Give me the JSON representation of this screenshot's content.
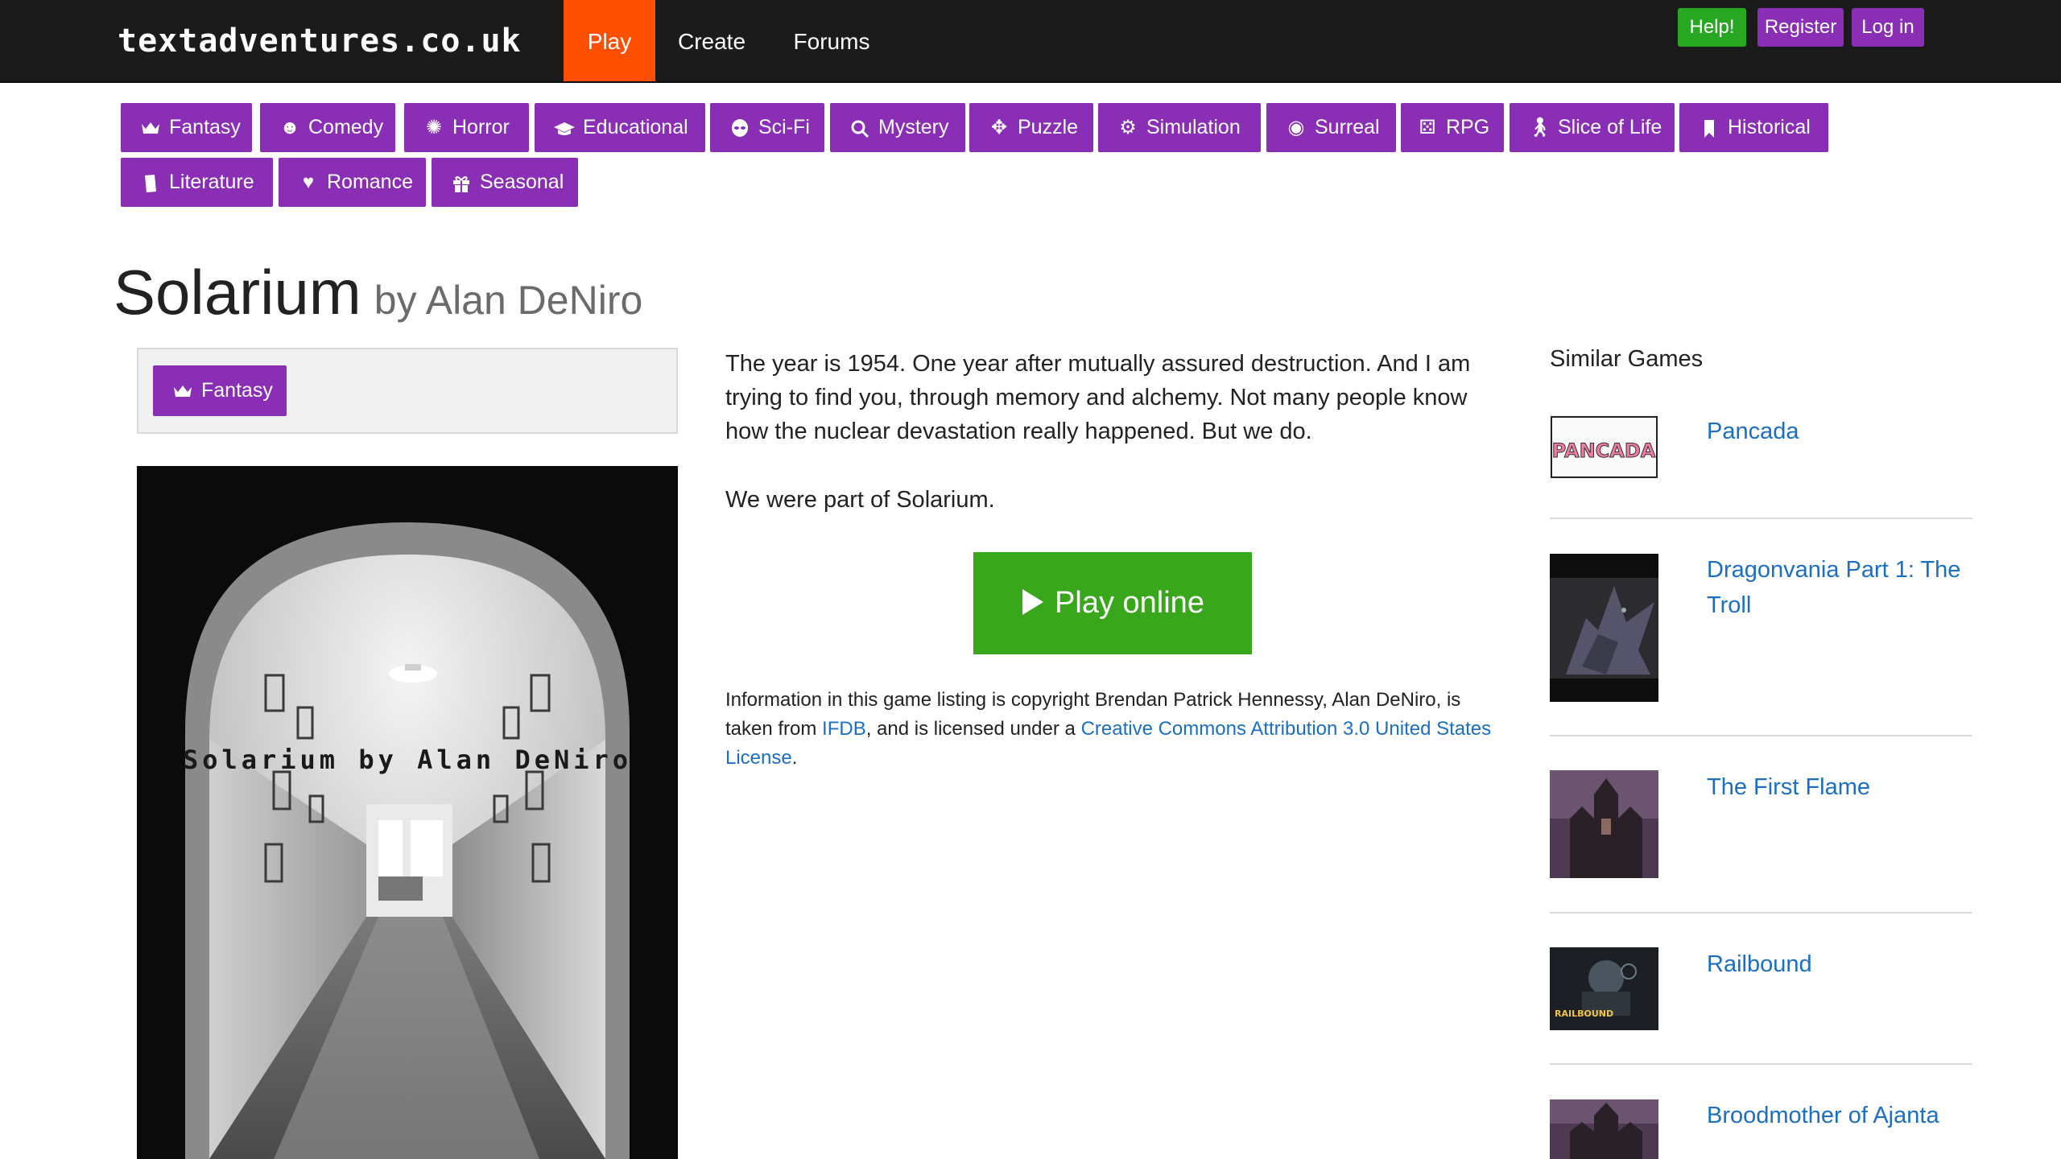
{
  "site": {
    "logo": "textadventures.co.uk",
    "nav": [
      {
        "label": "Play",
        "active": true
      },
      {
        "label": "Create",
        "active": false
      },
      {
        "label": "Forums",
        "active": false
      }
    ],
    "top_buttons": [
      {
        "label": "Help!",
        "color": "#27a722"
      },
      {
        "label": "Register",
        "color": "#8a2fb5"
      },
      {
        "label": "Log in",
        "color": "#8a2fb5"
      }
    ]
  },
  "categories": [
    {
      "label": "Fantasy",
      "icon": "crown-icon"
    },
    {
      "label": "Comedy",
      "icon": "smiley-icon"
    },
    {
      "label": "Horror",
      "icon": "spider-icon"
    },
    {
      "label": "Educational",
      "icon": "graduation-cap-icon"
    },
    {
      "label": "Sci-Fi",
      "icon": "alien-icon"
    },
    {
      "label": "Mystery",
      "icon": "magnifier-icon"
    },
    {
      "label": "Puzzle",
      "icon": "puzzle-icon"
    },
    {
      "label": "Simulation",
      "icon": "gears-icon"
    },
    {
      "label": "Surreal",
      "icon": "spiral-icon"
    },
    {
      "label": "RPG",
      "icon": "dice-icon"
    },
    {
      "label": "Slice of Life",
      "icon": "walking-person-icon"
    },
    {
      "label": "Historical",
      "icon": "bookmark-icon"
    },
    {
      "label": "Literature",
      "icon": "book-icon"
    },
    {
      "label": "Romance",
      "icon": "heart-icon"
    },
    {
      "label": "Seasonal",
      "icon": "gift-icon"
    }
  ],
  "game": {
    "title": "Solarium",
    "author": "by Alan DeNiro",
    "genre_tag": "Fantasy",
    "cover_text": "Solarium by Alan DeNiro",
    "description": [
      "The year is 1954. One year after mutually assured destruction. And I am trying to find you, through memory and alchemy. Not many people know how the nuclear devastation really happened. But we do.",
      "We were part of Solarium."
    ],
    "play_label": "Play online",
    "license": {
      "text1": "Information in this game listing is copyright Brendan Patrick Hennessy, Alan DeNiro, is taken from ",
      "link1": "IFDB",
      "text2": ", and is licensed under a ",
      "link2": "Creative Commons Attribution 3.0 United States License",
      "text3": "."
    }
  },
  "similar": {
    "heading": "Similar Games",
    "items": [
      {
        "title": "Pancada",
        "thumb_text": "PANCADA"
      },
      {
        "title": "Dragonvania Part 1: The Troll",
        "thumb_text": ""
      },
      {
        "title": "The First Flame",
        "thumb_text": ""
      },
      {
        "title": "Railbound",
        "thumb_text": "RAILBOUND"
      },
      {
        "title": "Broodmother of Ajanta",
        "thumb_text": ""
      }
    ]
  }
}
